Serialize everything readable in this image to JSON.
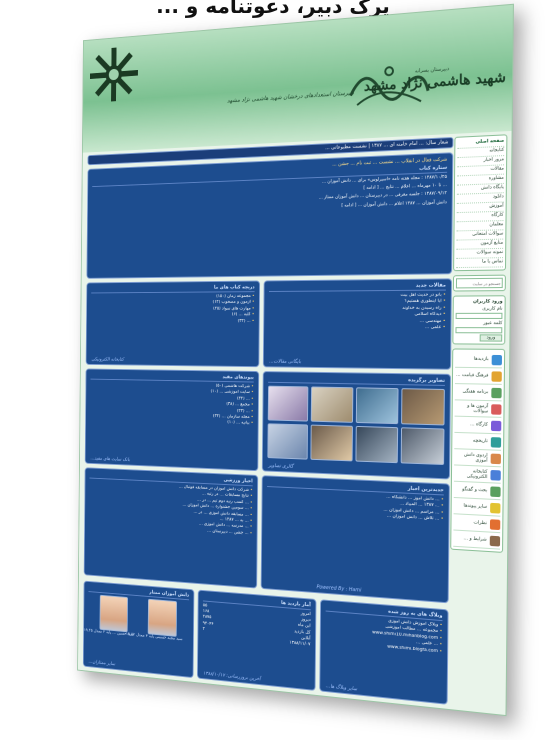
{
  "caption": "پرک دبیر، دعوتنامه و ...",
  "header": {
    "emblem_text": "الله",
    "school_sub": "دبیرستان پسرانه",
    "school_title": "شهید هاشمی نژاد مشهد",
    "calligraphy_text": "امام رضا",
    "slogan": "دبیرستان استعدادهای درخشان شهید هاشمی نژاد مشهد"
  },
  "breadcrumb": "شعار سال: ... امام خامنه ای ... ۱۳۸۷ | نشست مطبوعاتی ...",
  "top_news": {
    "ticker": "شرکت فعال در انقلاب ... نشست ... ثبت نام ... جشن ...",
    "title": "ستاره کتاب",
    "items": [
      "۱۳۸۷/۱۰/۲۵ : مجله هفته نامه «اسپرلوس» برای ... دانش آموزان ...",
      "... تا ۱۰ مهرماه ... اعلام ... نتایج ... [ ادامه ]",
      "۱۳۸۷/۰۹/۱۲ : جلسه معرفی ... در دبیرستان ... دانش آموزان ممتاز ...",
      "دانش آموزان ... ۱۳۸۷ اعلام ... دانش آموزان ... [ ادامه ]"
    ]
  },
  "panels": {
    "articles": {
      "title": "مقالات جدید",
      "items": [
        "بانو در حدیث اهل بیت",
        "آیا اینطوری هستیم؟",
        "راه رسیدن به خداوند",
        "دیدگاه اسلامی",
        "مهندسی ...",
        "علمی ..."
      ],
      "foot": "بایگانی مقالات..."
    },
    "books": {
      "title": "دریچه کتاب های ما",
      "items": [
        "مجموعه زمان (۱۵۰)",
        "آزمون و مصحوب (۱۲)",
        "مهارت های سواد (۲۵)",
        "کلیه ... (۶)",
        "... (۳۲)"
      ],
      "foot": "کتابخانه الکترونیکی"
    },
    "gallery": {
      "title": "تصاویر برگزیده",
      "foot": "گالری تصاویر"
    },
    "links": {
      "title": "پیوندهای مفید",
      "items": [
        "شرکت هاشمی (۵۰)",
        "سایت آموزشی ... (۱۰)",
        "... (۳۲)",
        "مجمع ... (۳۸)",
        "... (۲۳)",
        "مجله سازمان ... (۳۲)",
        "بیانیه ... (۱۰)"
      ],
      "foot": "بانک سایت های مفید..."
    },
    "topics": {
      "title": "اخبار ورزشی",
      "items": [
        "شرکت دانش آموزان در مسابقه فوتبال ...",
        "نتایج مسابقات ... در رتبه ...",
        "... کسب رتبه دوم تیم ... در ...",
        "... سومین جشنواره ... دانش آموزان ...",
        "... مسابقه دانش آموزی ... در ...",
        "... به ... ۱۳۸۷ ...",
        "... مدرسه ... دانش آموزی ...",
        "... جشن ... دبیرستان ..."
      ]
    },
    "latest_topics": {
      "title": "جدیدترین اخبار",
      "items": [
        "... دانش آموز ... دانشگاه ...",
        "... ۱۳۸۷ ... المپیاد ...",
        "... مراسم ... دانش آموزان ...",
        "... تلاش ... دانش آموزان ..."
      ],
      "foot": "Powered By : Hami"
    }
  },
  "footer": {
    "students": {
      "title": "دانش آموزان ممتاز",
      "people": [
        {
          "caption": "سید مجید حسینی پایه ۳ معدل ۱۹.۵۲"
        },
        {
          "caption": "سید حسین ... پایه ۲ معدل ۱۹.۴۵"
        }
      ],
      "foot": "سایر ممتازان..."
    },
    "stats": {
      "title": "آمار بازدید ها",
      "rows": [
        {
          "label": "امروز",
          "value": "۵۵"
        },
        {
          "label": "دیروز",
          "value": "۱۶۸"
        },
        {
          "label": "این ماه",
          "value": "۲۸۷۵"
        },
        {
          "label": "کل بازدید",
          "value": "۹۴۰۴۴"
        },
        {
          "label": "آنلاین",
          "value": "۲"
        }
      ],
      "date": "۱۳۸۸/۱۱/۰۷",
      "foot": "آخرین بروزرسانی: ۱۳۸۸/۱۰/۱۷"
    },
    "weblogs": {
      "title": "وبلاگ های به روز شده",
      "items": [
        "وبلاگ آموزش دانش آموزی",
        "مجموعه ... مطالب آموزشی",
        "www.shimi10.mihanblog.com",
        "... علمی ...",
        "www.shimi.blogfa.com"
      ],
      "foot": "سایر وبلاگ ها..."
    }
  },
  "sidebar": {
    "menu_title": "صفحه اصلی",
    "menu": [
      "کتابخانه",
      "مرور اخبار",
      "مقالات",
      "مشاوره",
      "پایگاه دانش",
      "دانلود",
      "آموزش",
      "کارگاه",
      "معلمان",
      "سوالات امتحانی",
      "منابع آزمون",
      "نمونه سوالات",
      "تماس با ما"
    ],
    "search_placeholder": "جستجو در سایت",
    "login": {
      "title": "ورود کاربران",
      "user_label": "نام کاربری",
      "pass_label": "کلمه عبور",
      "submit": "ورود"
    },
    "links": [
      {
        "label": "بازدیدها",
        "color": "#3c8fd6"
      },
      {
        "label": "فرهنگ قیامت ...",
        "color": "#e2a431"
      },
      {
        "label": "برنامه هفتگی",
        "color": "#5aa05f"
      },
      {
        "label": "آزمون ها و سوالات",
        "color": "#d95b5b"
      },
      {
        "label": "کارگاه ...",
        "color": "#7a5ad9"
      },
      {
        "label": "تاریخچه",
        "color": "#2f9e9a"
      },
      {
        "label": "اردوی دانش آموزی",
        "color": "#d9884a"
      },
      {
        "label": "کتابخانه الکترونیکی",
        "color": "#4a7fd9"
      },
      {
        "label": "بحث و گفتگو",
        "color": "#5aa05f"
      },
      {
        "label": "سایر پیوندها",
        "color": "#e2c331"
      },
      {
        "label": "نظرات",
        "color": "#e26f31"
      },
      {
        "label": "شرایط و ...",
        "color": "#8a6a4a"
      }
    ]
  },
  "colors": {
    "header_green": "#7cc191",
    "panel_blue": "#1d4d8f",
    "page_bg": "#e9f4ea"
  }
}
